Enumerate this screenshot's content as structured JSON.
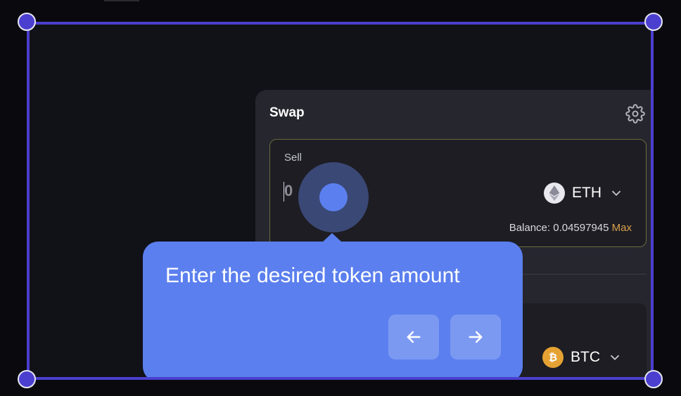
{
  "swap": {
    "title": "Swap",
    "sell": {
      "label": "Sell",
      "amount": "0",
      "token": "ETH",
      "balance_label": "Balance: 0.04597945",
      "max_label": "Max"
    },
    "buy": {
      "token": "BTC"
    }
  },
  "tour": {
    "text": "Enter the desired token amount",
    "prev_icon": "arrow-left-icon",
    "next_icon": "arrow-right-icon"
  },
  "colors": {
    "selection_frame": "#4b3fd0",
    "tooltip_bg": "#5b7fee",
    "max_link": "#d8a24a",
    "btc_coin": "#e5a233"
  }
}
